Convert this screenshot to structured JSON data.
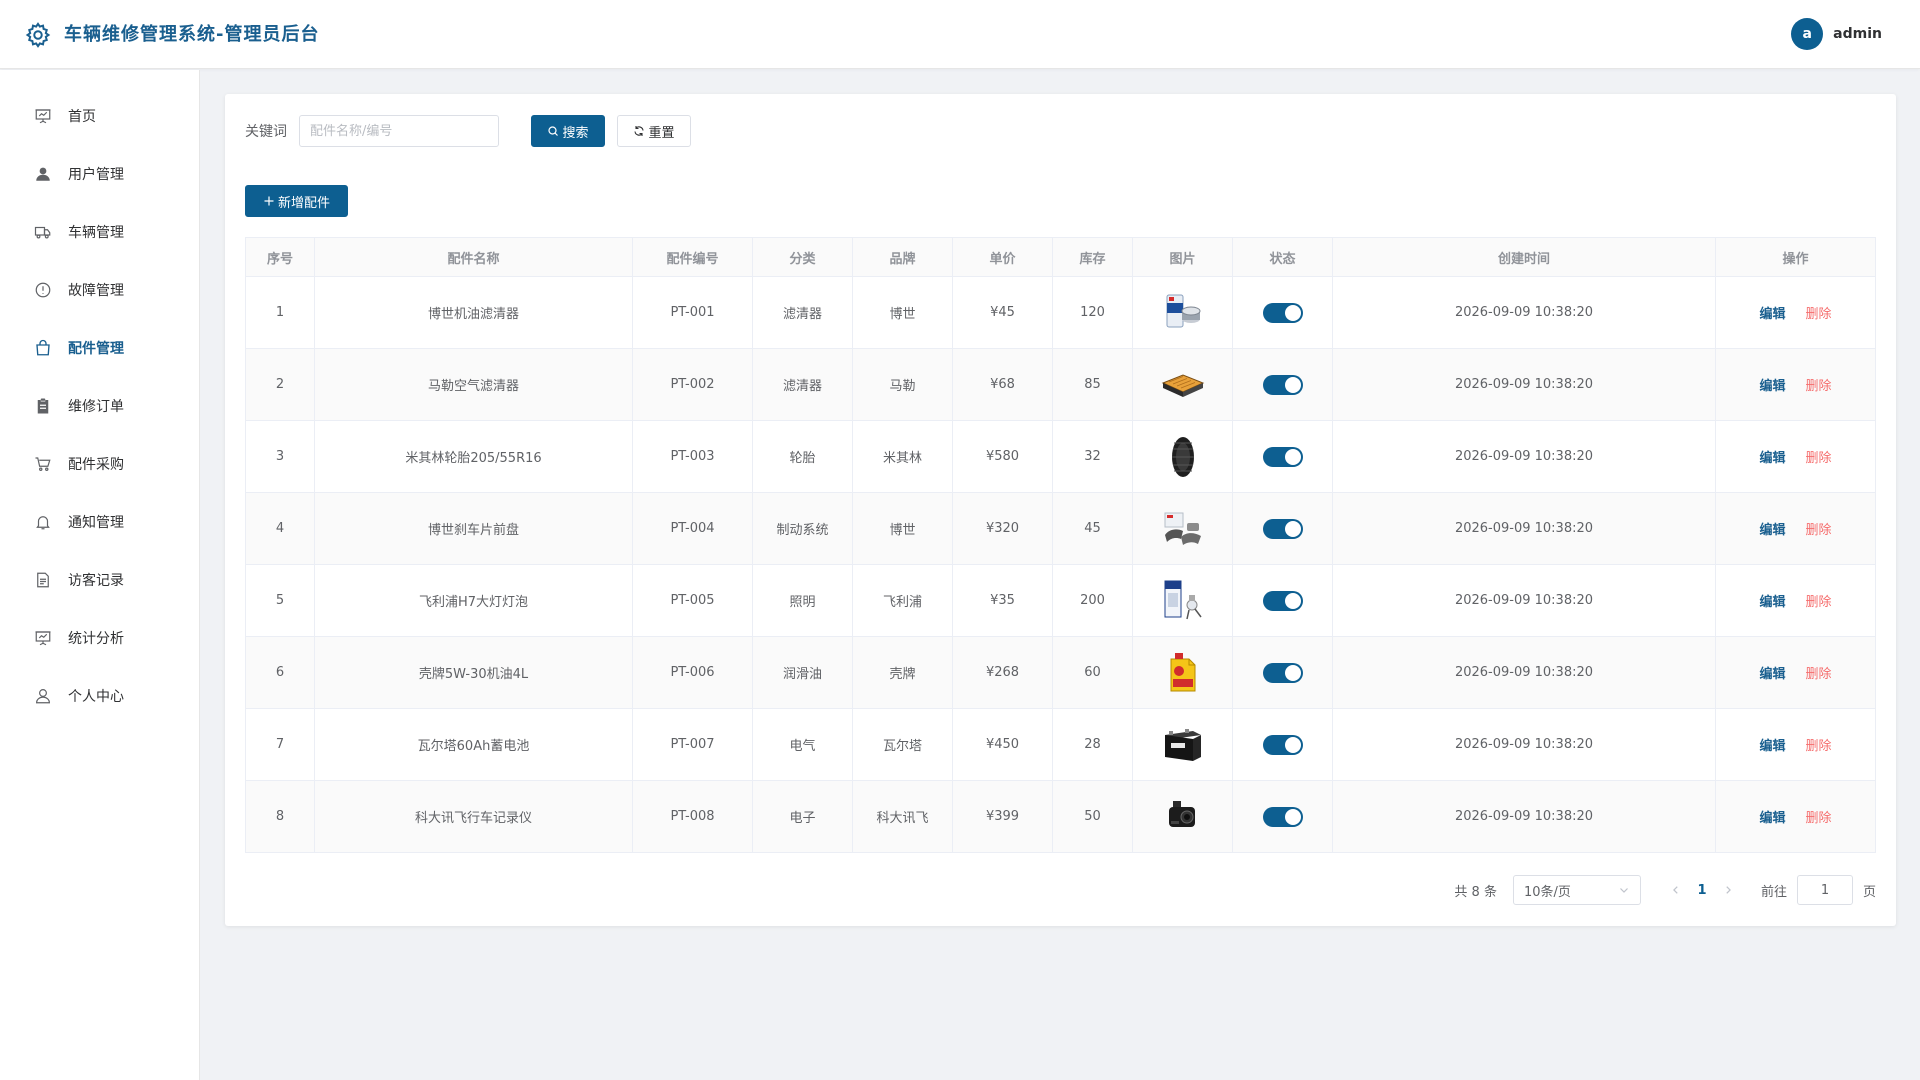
{
  "header": {
    "title": "车辆维修管理系统-管理员后台",
    "avatar_letter": "a",
    "username": "admin"
  },
  "sidebar": {
    "items": [
      {
        "label": "首页",
        "icon": "presentation-icon"
      },
      {
        "label": "用户管理",
        "icon": "user-icon"
      },
      {
        "label": "车辆管理",
        "icon": "truck-icon"
      },
      {
        "label": "故障管理",
        "icon": "warning-circle-icon"
      },
      {
        "label": "配件管理",
        "icon": "bag-icon",
        "active": true
      },
      {
        "label": "维修订单",
        "icon": "clipboard-icon"
      },
      {
        "label": "配件采购",
        "icon": "cart-icon"
      },
      {
        "label": "通知管理",
        "icon": "bell-icon"
      },
      {
        "label": "访客记录",
        "icon": "document-icon"
      },
      {
        "label": "统计分析",
        "icon": "data-board-icon"
      },
      {
        "label": "个人中心",
        "icon": "person-icon"
      }
    ]
  },
  "search": {
    "label": "关键词",
    "placeholder": "配件名称/编号",
    "value": "",
    "search_label": "搜索",
    "reset_label": "重置"
  },
  "toolbar": {
    "add_label": "新增配件"
  },
  "table": {
    "columns": [
      "序号",
      "配件名称",
      "配件编号",
      "分类",
      "品牌",
      "单价",
      "库存",
      "图片",
      "状态",
      "创建时间",
      "操作"
    ],
    "edit_label": "编辑",
    "delete_label": "删除",
    "rows": [
      {
        "index": "1",
        "name": "博世机油滤清器",
        "code": "PT-001",
        "category": "滤清器",
        "brand": "博世",
        "price": "¥45",
        "stock": "120",
        "image": "oil-filter",
        "enabled": true,
        "created": "2026-09-09 10:38:20"
      },
      {
        "index": "2",
        "name": "马勒空气滤清器",
        "code": "PT-002",
        "category": "滤清器",
        "brand": "马勒",
        "price": "¥68",
        "stock": "85",
        "image": "air-filter",
        "enabled": true,
        "created": "2026-09-09 10:38:20"
      },
      {
        "index": "3",
        "name": "米其林轮胎205/55R16",
        "code": "PT-003",
        "category": "轮胎",
        "brand": "米其林",
        "price": "¥580",
        "stock": "32",
        "image": "tire",
        "enabled": true,
        "created": "2026-09-09 10:38:20"
      },
      {
        "index": "4",
        "name": "博世刹车片前盘",
        "code": "PT-004",
        "category": "制动系统",
        "brand": "博世",
        "price": "¥320",
        "stock": "45",
        "image": "brake-pads",
        "enabled": true,
        "created": "2026-09-09 10:38:20"
      },
      {
        "index": "5",
        "name": "飞利浦H7大灯灯泡",
        "code": "PT-005",
        "category": "照明",
        "brand": "飞利浦",
        "price": "¥35",
        "stock": "200",
        "image": "headlight-bulb",
        "enabled": true,
        "created": "2026-09-09 10:38:20"
      },
      {
        "index": "6",
        "name": "壳牌5W-30机油4L",
        "code": "PT-006",
        "category": "润滑油",
        "brand": "壳牌",
        "price": "¥268",
        "stock": "60",
        "image": "engine-oil",
        "enabled": true,
        "created": "2026-09-09 10:38:20"
      },
      {
        "index": "7",
        "name": "瓦尔塔60Ah蓄电池",
        "code": "PT-007",
        "category": "电气",
        "brand": "瓦尔塔",
        "price": "¥450",
        "stock": "28",
        "image": "battery",
        "enabled": true,
        "created": "2026-09-09 10:38:20"
      },
      {
        "index": "8",
        "name": "科大讯飞行车记录仪",
        "code": "PT-008",
        "category": "电子",
        "brand": "科大讯飞",
        "price": "¥399",
        "stock": "50",
        "image": "dashcam",
        "enabled": true,
        "created": "2026-09-09 10:38:20"
      }
    ]
  },
  "pagination": {
    "total": "共 8 条",
    "page_size": "10条/页",
    "current_page": "1",
    "goto_label": "前往",
    "goto_value": "1",
    "unit_label": "页"
  },
  "colors": {
    "primary": "#0d5f91",
    "title": "#1a5f8f",
    "danger": "#f56c6c"
  }
}
